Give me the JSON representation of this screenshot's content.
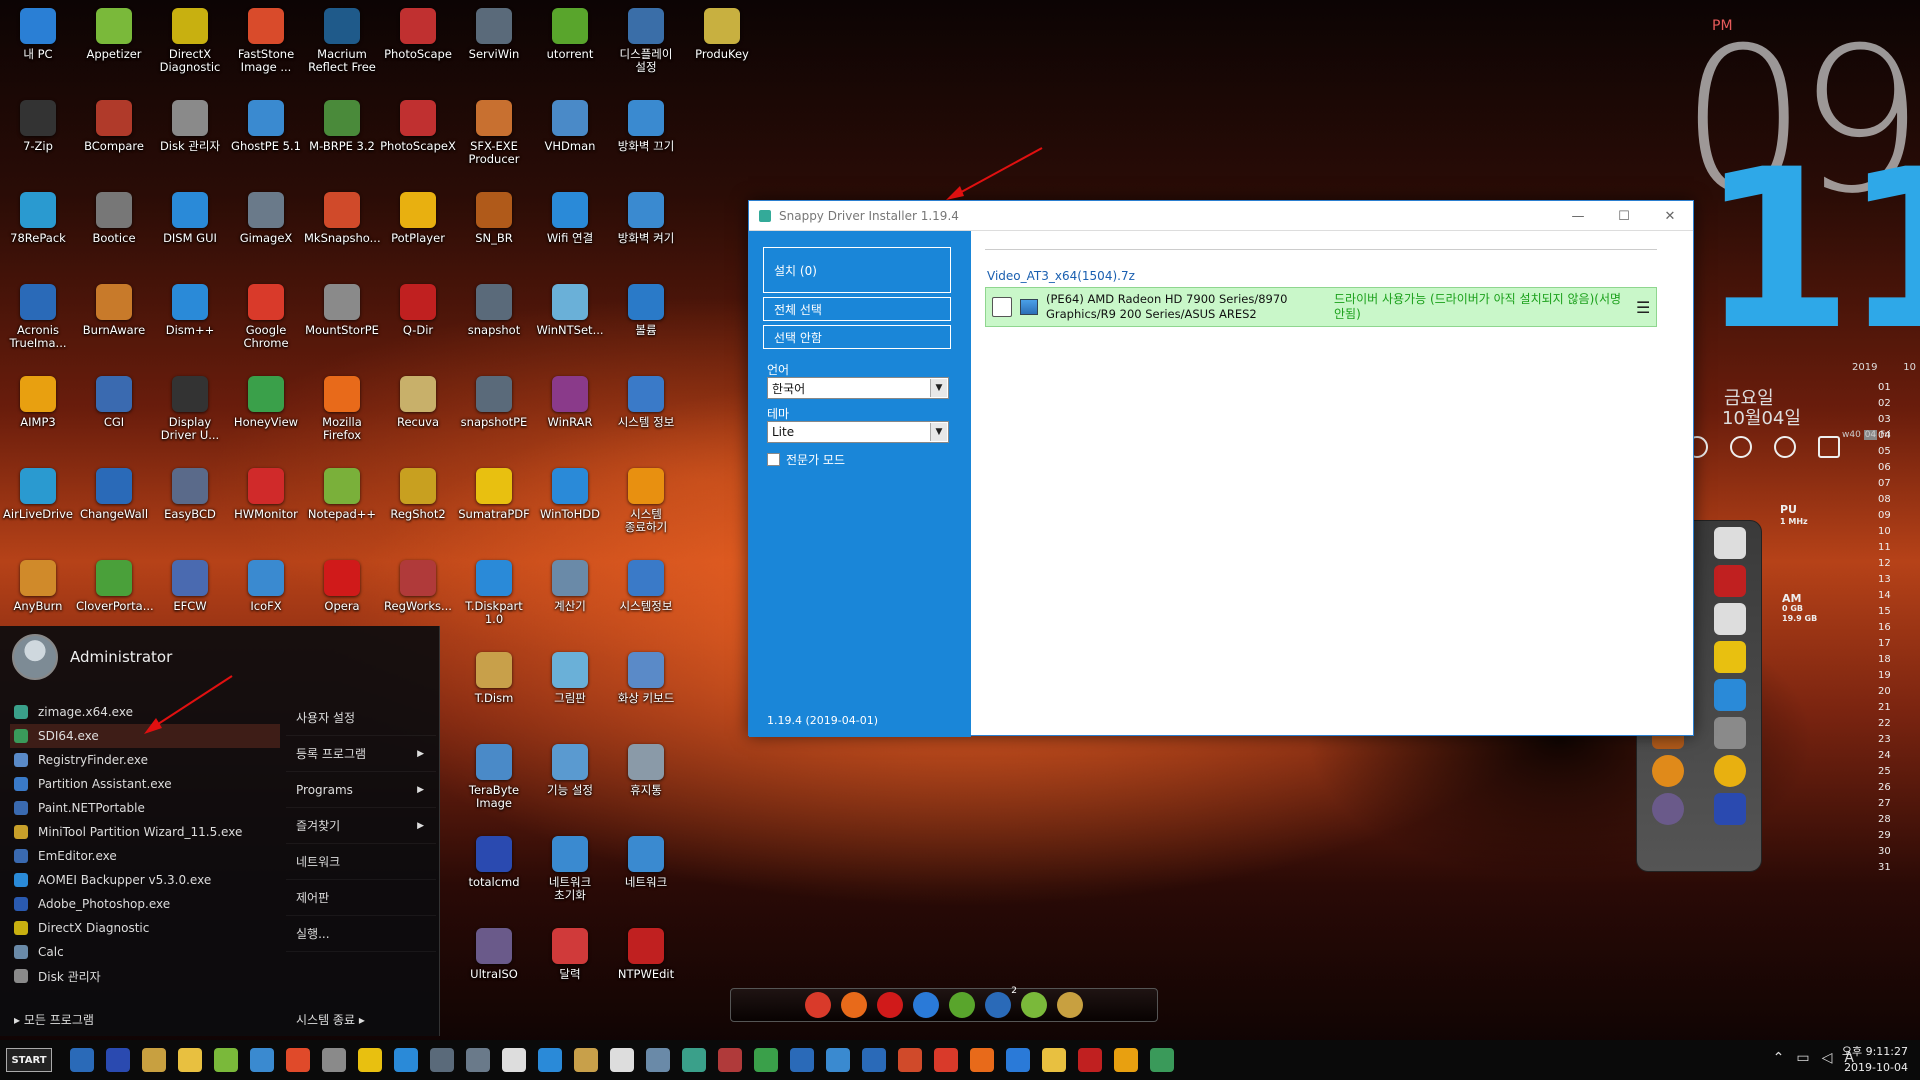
{
  "desktop_icons": [
    {
      "label": "내 PC",
      "col": 0,
      "row": 0,
      "color": "#2a7fd5",
      "icon": "computer-icon"
    },
    {
      "label": "Appetizer",
      "col": 1,
      "row": 0,
      "color": "#7ab93a",
      "icon": "appetizer-icon"
    },
    {
      "label": "DirectX Diagnostic",
      "col": 2,
      "row": 0,
      "color": "#c8b010",
      "icon": "directx-icon"
    },
    {
      "label": "FastStone Image ...",
      "col": 3,
      "row": 0,
      "color": "#d94b2b",
      "icon": "faststone-icon"
    },
    {
      "label": "Macrium Reflect Free",
      "col": 4,
      "row": 0,
      "color": "#1f5a8a",
      "icon": "macrium-icon"
    },
    {
      "label": "PhotoScape",
      "col": 5,
      "row": 0,
      "color": "#c03030",
      "icon": "photoscape-icon"
    },
    {
      "label": "ServiWin",
      "col": 6,
      "row": 0,
      "color": "#5a6a7a",
      "icon": "serviwin-icon"
    },
    {
      "label": "utorrent",
      "col": 7,
      "row": 0,
      "color": "#59a52c",
      "icon": "utorrent-icon"
    },
    {
      "label": "디스플레이 설정",
      "col": 8,
      "row": 0,
      "color": "#3a6ea8",
      "icon": "display-icon"
    },
    {
      "label": "ProduKey",
      "col": 9,
      "row": 0,
      "color": "#c8b040",
      "icon": "key-icon"
    },
    {
      "label": "7-Zip",
      "col": 0,
      "row": 1,
      "color": "#333333",
      "icon": "zip-icon"
    },
    {
      "label": "BCompare",
      "col": 1,
      "row": 1,
      "color": "#b03a2a",
      "icon": "bcompare-icon"
    },
    {
      "label": "Disk 관리자",
      "col": 2,
      "row": 1,
      "color": "#8a8a8a",
      "icon": "disk-icon"
    },
    {
      "label": "GhostPE 5.1",
      "col": 3,
      "row": 1,
      "color": "#3a8ad0",
      "icon": "ghost-icon"
    },
    {
      "label": "M-BRPE 3.2",
      "col": 4,
      "row": 1,
      "color": "#4a8a3a",
      "icon": "drive-icon"
    },
    {
      "label": "PhotoScapeX",
      "col": 5,
      "row": 1,
      "color": "#c03030",
      "icon": "photoscapex-icon"
    },
    {
      "label": "SFX-EXE Producer",
      "col": 6,
      "row": 1,
      "color": "#c87030",
      "icon": "package-icon"
    },
    {
      "label": "VHDman",
      "col": 7,
      "row": 1,
      "color": "#4a8ac8",
      "icon": "vhd-icon"
    },
    {
      "label": "방화벽 끄기",
      "col": 8,
      "row": 1,
      "color": "#3a8ad0",
      "icon": "firewall-off-icon"
    },
    {
      "label": "78RePack",
      "col": 0,
      "row": 2,
      "color": "#2a9ad0",
      "icon": "repack-icon"
    },
    {
      "label": "Bootice",
      "col": 1,
      "row": 2,
      "color": "#777777",
      "icon": "bootice-icon"
    },
    {
      "label": "DISM GUI",
      "col": 2,
      "row": 2,
      "color": "#2a8ad8",
      "icon": "windows-icon"
    },
    {
      "label": "GimageX",
      "col": 3,
      "row": 2,
      "color": "#6a7a8a",
      "icon": "gimagex-icon"
    },
    {
      "label": "MkSnapsho...",
      "col": 4,
      "row": 2,
      "color": "#d04a2a",
      "icon": "mksnapshot-icon"
    },
    {
      "label": "PotPlayer",
      "col": 5,
      "row": 2,
      "color": "#e8b010",
      "icon": "potplayer-icon"
    },
    {
      "label": "SN_BR",
      "col": 6,
      "row": 2,
      "color": "#b05a1a",
      "icon": "bridge-icon"
    },
    {
      "label": "Wifi 연결",
      "col": 7,
      "row": 2,
      "color": "#2a8ad8",
      "icon": "wifi-icon"
    },
    {
      "label": "방화벽 켜기",
      "col": 8,
      "row": 2,
      "color": "#3a8ad0",
      "icon": "firewall-on-icon"
    },
    {
      "label": "Acronis TrueIma...",
      "col": 0,
      "row": 3,
      "color": "#2a6ab8",
      "icon": "acronis-icon"
    },
    {
      "label": "BurnAware",
      "col": 1,
      "row": 3,
      "color": "#c87a2a",
      "icon": "burnaware-icon"
    },
    {
      "label": "Dism++",
      "col": 2,
      "row": 3,
      "color": "#2a8ad8",
      "icon": "gear-icon"
    },
    {
      "label": "Google Chrome",
      "col": 3,
      "row": 3,
      "color": "#d93a2a",
      "icon": "chrome-icon"
    },
    {
      "label": "MountStorPE",
      "col": 4,
      "row": 3,
      "color": "#8a8a8a",
      "icon": "mount-icon"
    },
    {
      "label": "Q-Dir",
      "col": 5,
      "row": 3,
      "color": "#c02020",
      "icon": "qdir-icon"
    },
    {
      "label": "snapshot",
      "col": 6,
      "row": 3,
      "color": "#5a6a7a",
      "icon": "snapshot-icon"
    },
    {
      "label": "WinNTSet...",
      "col": 7,
      "row": 3,
      "color": "#6ab0d8",
      "icon": "winntsetup-icon"
    },
    {
      "label": "볼륨",
      "col": 8,
      "row": 3,
      "color": "#2a7ac8",
      "icon": "volume-icon"
    },
    {
      "label": "AIMP3",
      "col": 0,
      "row": 4,
      "color": "#e8a010",
      "icon": "aimp-icon"
    },
    {
      "label": "CGI",
      "col": 1,
      "row": 4,
      "color": "#3a6ab0",
      "icon": "cgi-icon"
    },
    {
      "label": "Display Driver U...",
      "col": 2,
      "row": 4,
      "color": "#333333",
      "icon": "ddu-icon"
    },
    {
      "label": "HoneyView",
      "col": 3,
      "row": 4,
      "color": "#3aa04a",
      "icon": "honeyview-icon"
    },
    {
      "label": "Mozilla Firefox",
      "col": 4,
      "row": 4,
      "color": "#e86a1a",
      "icon": "firefox-icon"
    },
    {
      "label": "Recuva",
      "col": 5,
      "row": 4,
      "color": "#c8b06a",
      "icon": "recuva-icon"
    },
    {
      "label": "snapshotPE",
      "col": 6,
      "row": 4,
      "color": "#5a6a7a",
      "icon": "snapshotpe-icon"
    },
    {
      "label": "WinRAR",
      "col": 7,
      "row": 4,
      "color": "#8a3a8a",
      "icon": "winrar-icon"
    },
    {
      "label": "시스템 정보",
      "col": 8,
      "row": 4,
      "color": "#3a7ac8",
      "icon": "sysinfo-icon"
    },
    {
      "label": "AirLiveDrive",
      "col": 0,
      "row": 5,
      "color": "#2a9ad0",
      "icon": "airlive-icon"
    },
    {
      "label": "ChangeWall",
      "col": 1,
      "row": 5,
      "color": "#2a6ab8",
      "icon": "changewall-icon"
    },
    {
      "label": "EasyBCD",
      "col": 2,
      "row": 5,
      "color": "#5a6a8a",
      "icon": "easybcd-icon"
    },
    {
      "label": "HWMonitor",
      "col": 3,
      "row": 5,
      "color": "#d02a2a",
      "icon": "hwmonitor-icon"
    },
    {
      "label": "Notepad++",
      "col": 4,
      "row": 5,
      "color": "#7ab03a",
      "icon": "notepad-icon"
    },
    {
      "label": "RegShot2",
      "col": 5,
      "row": 5,
      "color": "#c8a020",
      "icon": "regshot-icon"
    },
    {
      "label": "SumatraPDF",
      "col": 6,
      "row": 5,
      "color": "#e8c010",
      "icon": "pdf-icon"
    },
    {
      "label": "WinToHDD",
      "col": 7,
      "row": 5,
      "color": "#2a8ad8",
      "icon": "wintohdd-icon"
    },
    {
      "label": "시스템 종료하기",
      "col": 8,
      "row": 5,
      "color": "#e89010",
      "icon": "power-icon"
    },
    {
      "label": "AnyBurn",
      "col": 0,
      "row": 6,
      "color": "#d08a2a",
      "icon": "anyburn-icon"
    },
    {
      "label": "CloverPorta...",
      "col": 1,
      "row": 6,
      "color": "#4aa03a",
      "icon": "clover-icon"
    },
    {
      "label": "EFCW",
      "col": 2,
      "row": 6,
      "color": "#4a6ab0",
      "icon": "efcw-icon"
    },
    {
      "label": "IcoFX",
      "col": 3,
      "row": 6,
      "color": "#3a8ad0",
      "icon": "icofx-icon"
    },
    {
      "label": "Opera",
      "col": 4,
      "row": 6,
      "color": "#d01a1a",
      "icon": "opera-icon"
    },
    {
      "label": "RegWorks...",
      "col": 5,
      "row": 6,
      "color": "#b03a3a",
      "icon": "regworks-icon"
    },
    {
      "label": "T.Diskpart 1.0",
      "col": 6,
      "row": 6,
      "color": "#2a8ad8",
      "icon": "diskpart-icon"
    },
    {
      "label": "계산기",
      "col": 7,
      "row": 6,
      "color": "#6a8aa8",
      "icon": "calculator-icon"
    },
    {
      "label": "시스템정보",
      "col": 8,
      "row": 6,
      "color": "#3a7ac8",
      "icon": "sysinfo2-icon"
    },
    {
      "label": "T.Dism",
      "col": 6,
      "row": 7,
      "color": "#c8a04a",
      "icon": "tdism-icon"
    },
    {
      "label": "그림판",
      "col": 7,
      "row": 7,
      "color": "#6ab0d8",
      "icon": "paint-icon"
    },
    {
      "label": "화상 키보드",
      "col": 8,
      "row": 7,
      "color": "#5a8ac8",
      "icon": "keyboard-icon"
    },
    {
      "label": "TeraByte Image",
      "col": 6,
      "row": 8,
      "color": "#4a8ac8",
      "icon": "terabyte-icon"
    },
    {
      "label": "기능 설정",
      "col": 7,
      "row": 8,
      "color": "#5a9ad0",
      "icon": "settings-icon"
    },
    {
      "label": "휴지통",
      "col": 8,
      "row": 8,
      "color": "#8a9aa8",
      "icon": "recycle-bin-icon"
    },
    {
      "label": "totalcmd",
      "col": 6,
      "row": 9,
      "color": "#2a4ab0",
      "icon": "floppy-icon"
    },
    {
      "label": "네트워크 초기화",
      "col": 7,
      "row": 9,
      "color": "#3a8ad0",
      "icon": "network-reset-icon"
    },
    {
      "label": "네트워크",
      "col": 8,
      "row": 9,
      "color": "#3a8ad0",
      "icon": "network-icon"
    },
    {
      "label": "UltraISO",
      "col": 6,
      "row": 10,
      "color": "#6a5a8a",
      "icon": "ultraiso-icon"
    },
    {
      "label": "달력",
      "col": 7,
      "row": 10,
      "color": "#d03a3a",
      "icon": "calendar-icon"
    },
    {
      "label": "NTPWEdit",
      "col": 8,
      "row": 10,
      "color": "#c02020",
      "icon": "ntpwedit-icon"
    }
  ],
  "start_menu": {
    "username": "Administrator",
    "items": [
      {
        "label": "zimage.x64.exe",
        "color": "#3aa08a"
      },
      {
        "label": "SDI64.exe",
        "color": "#3a9a5a",
        "active": true
      },
      {
        "label": "RegistryFinder.exe",
        "color": "#5a8ac8"
      },
      {
        "label": "Partition Assistant.exe",
        "color": "#3a7ac8"
      },
      {
        "label": "Paint.NETPortable",
        "color": "#3a6ab0"
      },
      {
        "label": "MiniTool Partition Wizard_11.5.exe",
        "color": "#c8a02a"
      },
      {
        "label": "EmEditor.exe",
        "color": "#3a6ab0"
      },
      {
        "label": "AOMEI Backupper v5.3.0.exe",
        "color": "#2a8ad8"
      },
      {
        "label": "Adobe_Photoshop.exe",
        "color": "#2a5ab0"
      },
      {
        "label": "DirectX Diagnostic",
        "color": "#c8b010"
      },
      {
        "label": "Calc",
        "color": "#6a8aa8"
      },
      {
        "label": "Disk 관리자",
        "color": "#8a8a8a"
      }
    ],
    "right_items": [
      {
        "label": "사용자 설정",
        "arrow": ""
      },
      {
        "label": "등록 프로그램",
        "arrow": "▶"
      },
      {
        "label": "Programs",
        "arrow": "▶"
      },
      {
        "label": "즐겨찾기",
        "arrow": "▶"
      },
      {
        "label": "네트워크",
        "arrow": ""
      },
      {
        "label": "제어판",
        "arrow": ""
      },
      {
        "label": "실행...",
        "arrow": ""
      }
    ],
    "all_programs": "▸ 모든 프로그램",
    "shutdown": "시스템 종료   ▸"
  },
  "sdi": {
    "title": "Snappy Driver Installer 1.19.4",
    "install_btn": "설치 (0)",
    "select_all_btn": "전체 선택",
    "deselect_btn": "선택 안함",
    "language_label": "언어",
    "language_value": "한국어",
    "theme_label": "테마",
    "theme_value": "Lite",
    "expert_mode": "전문가 모드",
    "version": "1.19.4 (2019-04-01)",
    "package": "Video_AT3_x64(1504).7z",
    "driver_name": "(PE64) AMD Radeon HD 7900 Series/8970 Graphics/R9 200 Series/ASUS ARES2",
    "driver_status": "드라이버 사용가능 (드라이버가 아직 설치되지 않음)(서명 안됨)"
  },
  "clock": {
    "ampm": "PM",
    "hour": "09",
    "minute": "11",
    "weekday": "금요일",
    "month_day": "10월04일"
  },
  "calendar": {
    "year": "2019",
    "month": "10",
    "week": "w40",
    "today": "04",
    "today_day": "Fri",
    "days": [
      "01",
      "02",
      "03",
      "04",
      "05",
      "06",
      "07",
      "08",
      "09",
      "10",
      "11",
      "12",
      "13",
      "14",
      "15",
      "16",
      "17",
      "18",
      "19",
      "20",
      "21",
      "22",
      "23",
      "24",
      "25",
      "26",
      "27",
      "28",
      "29",
      "30",
      "31"
    ]
  },
  "gadgets": {
    "cpu_label": "PU",
    "cpu_sub": "1 MHz",
    "ram_label": "AM",
    "ram_sub1": "0 GB",
    "ram_sub2": "19.9 GB"
  },
  "taskbar": {
    "start": "START",
    "time": "오후 9:11:27",
    "date": "2019-10-04",
    "ime": "A",
    "badge": "2"
  }
}
